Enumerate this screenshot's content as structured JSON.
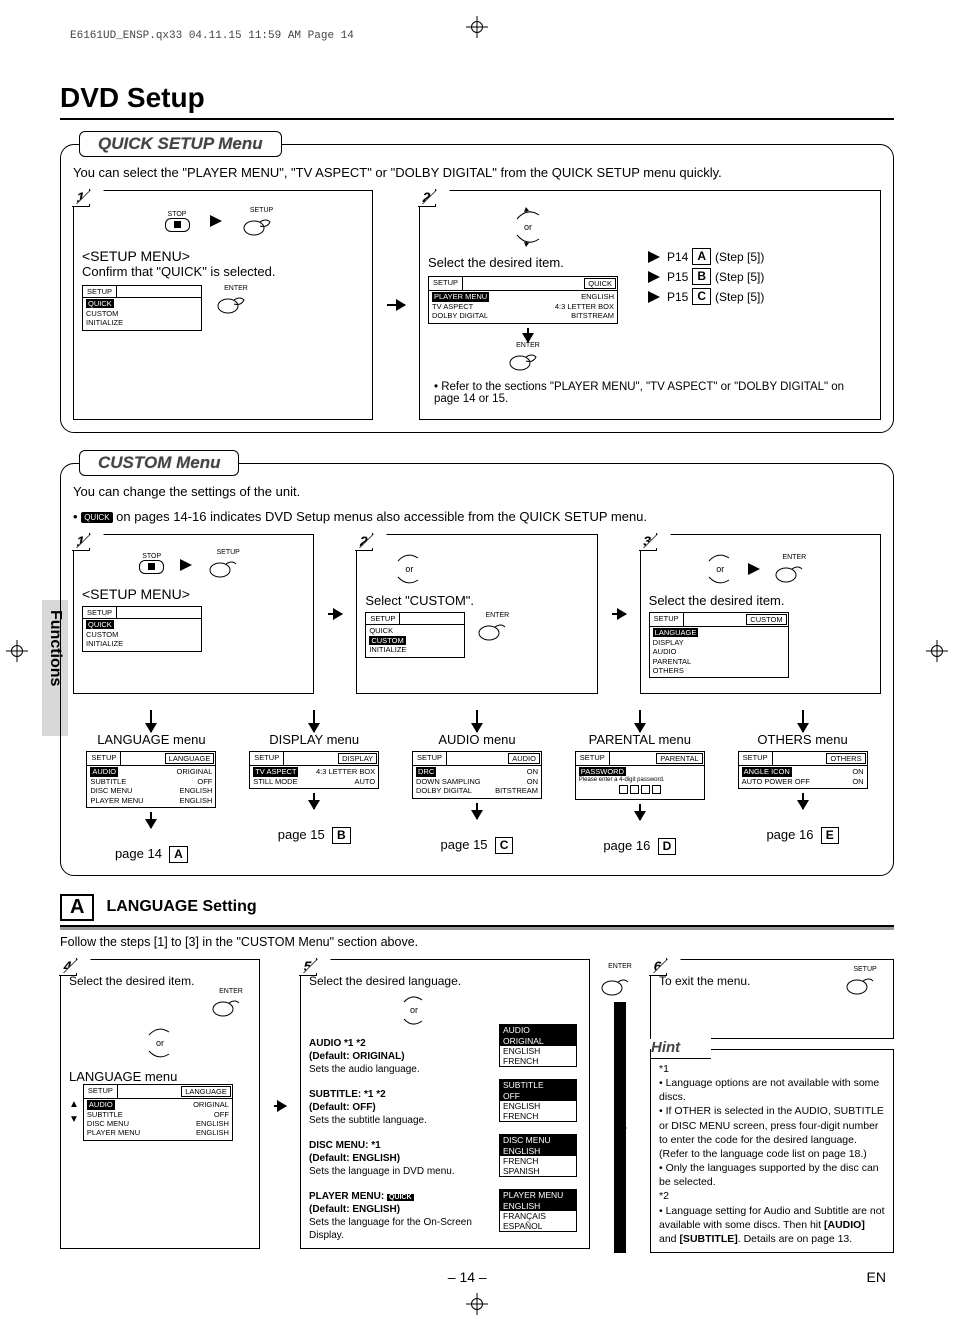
{
  "print_header": "E6161UD_ENSP.qx33  04.11.15 11:59 AM  Page 14",
  "title": "DVD Setup",
  "side_tab": "Functions",
  "quick": {
    "title": "QUICK SETUP Menu",
    "intro": "You can select the \"PLAYER MENU\", \"TV ASPECT\" or \"DOLBY DIGITAL\" from the QUICK SETUP menu quickly.",
    "step1": {
      "num": "1",
      "stop_label": "STOP",
      "setup_label": "SETUP",
      "heading": "<SETUP MENU>",
      "desc": "Confirm that \"QUICK\" is selected.",
      "menu_top": "SETUP",
      "menu_items": [
        "QUICK",
        "CUSTOM",
        "INITIALIZE"
      ],
      "enter_label": "ENTER"
    },
    "step2": {
      "num": "2",
      "or": "or",
      "desc": "Select the desired item.",
      "menu_top_l": "SETUP",
      "menu_top_r": "QUICK",
      "rows": [
        {
          "l": "PLAYER MENU",
          "r": "ENGLISH"
        },
        {
          "l": "TV ASPECT",
          "r": "4:3 LETTER BOX"
        },
        {
          "l": "DOLBY DIGITAL",
          "r": "BITSTREAM"
        }
      ],
      "enter_label": "ENTER",
      "ptrs": [
        {
          "p": "P14",
          "box": "A",
          "s": "(Step [5])"
        },
        {
          "p": "P15",
          "box": "B",
          "s": "(Step [5])"
        },
        {
          "p": "P15",
          "box": "C",
          "s": "(Step [5])"
        }
      ],
      "note": "• Refer to the sections \"PLAYER MENU\", \"TV ASPECT\" or \"DOLBY DIGITAL\" on page 14 or 15."
    }
  },
  "custom": {
    "title": "CUSTOM Menu",
    "intro1": "You can change the settings of the unit.",
    "intro2a": "•",
    "intro2_badge": "QUICK",
    "intro2b": " on pages 14-16 indicates DVD Setup menus also accessible from the QUICK SETUP menu.",
    "step1": {
      "num": "1",
      "stop_label": "STOP",
      "setup_label": "SETUP",
      "heading": "<SETUP MENU>",
      "menu_top": "SETUP",
      "menu_items": [
        "QUICK",
        "CUSTOM",
        "INITIALIZE"
      ]
    },
    "step2": {
      "num": "2",
      "or": "or",
      "desc": "Select \"CUSTOM\".",
      "menu_top": "SETUP",
      "menu_items": [
        "QUICK",
        "CUSTOM",
        "INITIALIZE"
      ],
      "enter_label": "ENTER"
    },
    "step3": {
      "num": "3",
      "or": "or",
      "enter_label": "ENTER",
      "desc": "Select the desired item.",
      "menu_top_l": "SETUP",
      "menu_top_r": "CUSTOM",
      "menu_items": [
        "LANGUAGE",
        "DISPLAY",
        "AUDIO",
        "PARENTAL",
        "OTHERS"
      ]
    },
    "menus": [
      {
        "title": "LANGUAGE menu",
        "top_l": "SETUP",
        "top_r": "LANGUAGE",
        "rows": [
          [
            "AUDIO",
            "ORIGINAL"
          ],
          [
            "SUBTITLE",
            "OFF"
          ],
          [
            "DISC MENU",
            "ENGLISH"
          ],
          [
            "PLAYER MENU",
            "ENGLISH"
          ]
        ],
        "page": "page 14",
        "box": "A"
      },
      {
        "title": "DISPLAY menu",
        "top_l": "SETUP",
        "top_r": "DISPLAY",
        "rows": [
          [
            "TV ASPECT",
            "4:3 LETTER BOX"
          ],
          [
            "STILL MODE",
            "AUTO"
          ]
        ],
        "page": "page 15",
        "box": "B"
      },
      {
        "title": "AUDIO menu",
        "top_l": "SETUP",
        "top_r": "AUDIO",
        "rows": [
          [
            "DRC",
            "ON"
          ],
          [
            "DOWN SAMPLING",
            "ON"
          ],
          [
            "DOLBY DIGITAL",
            "BITSTREAM"
          ]
        ],
        "page": "page 15",
        "box": "C"
      },
      {
        "title": "PARENTAL menu",
        "top_l": "SETUP",
        "top_r": "PARENTAL",
        "pw_label": "PASSWORD",
        "pw_msg": "Please enter a 4-digit password.",
        "page": "page 16",
        "box": "D"
      },
      {
        "title": "OTHERS menu",
        "top_l": "SETUP",
        "top_r": "OTHERS",
        "rows": [
          [
            "ANGLE ICON",
            "ON"
          ],
          [
            "AUTO POWER OFF",
            "ON"
          ]
        ],
        "page": "page 16",
        "box": "E"
      }
    ]
  },
  "lang_section": {
    "box": "A",
    "title": "LANGUAGE Setting",
    "follow": "Follow the steps [1] to [3] in the \"CUSTOM Menu\" section above.",
    "step4": {
      "num": "4",
      "desc": "Select the desired item.",
      "or": "or",
      "enter_label": "ENTER",
      "menu_title": "LANGUAGE menu",
      "top_l": "SETUP",
      "top_r": "LANGUAGE",
      "rows": [
        [
          "AUDIO",
          "ORIGINAL"
        ],
        [
          "SUBTITLE",
          "OFF"
        ],
        [
          "DISC MENU",
          "ENGLISH"
        ],
        [
          "PLAYER MENU",
          "ENGLISH"
        ]
      ]
    },
    "step5": {
      "num": "5",
      "desc": "Select the desired language.",
      "or": "or",
      "enter_label": "ENTER",
      "opts": [
        {
          "h": "AUDIO *1 *2",
          "d": "(Default: ORIGINAL)",
          "t": "Sets the audio language.",
          "list_top": "AUDIO",
          "list": [
            "ORIGINAL",
            "ENGLISH",
            "FRENCH"
          ]
        },
        {
          "h": "SUBTITLE: *1 *2",
          "d": "(Default: OFF)",
          "t": "Sets the subtitle language.",
          "list_top": "SUBTITLE",
          "list": [
            "OFF",
            "ENGLISH",
            "FRENCH"
          ]
        },
        {
          "h": "DISC MENU: *1",
          "d": "(Default: ENGLISH)",
          "t": "Sets the language in DVD menu.",
          "list_top": "DISC MENU",
          "list": [
            "ENGLISH",
            "FRENCH",
            "SPANISH"
          ]
        },
        {
          "h": "PLAYER MENU:",
          "badge": "QUICK",
          "d": "(Default: ENGLISH)",
          "t": "Sets the language for the On-Screen Display.",
          "list_top": "PLAYER MENU",
          "list": [
            "ENGLISH",
            "FRANÇAIS",
            "ESPAÑOL"
          ]
        }
      ]
    },
    "step6": {
      "num": "6",
      "desc": "To exit the menu.",
      "setup_label": "SETUP"
    },
    "hint": {
      "title": "Hint",
      "star1": "*1",
      "b1": "• Language options are not available with some discs.",
      "b2": "• If OTHER is selected in the AUDIO, SUBTITLE or DISC MENU screen, press four-digit number to enter the code for the desired language. (Refer to the language code list on page 18.)",
      "b3": "• Only the languages supported by the disc can be selected.",
      "star2": "*2",
      "b4a": "• Language setting for Audio and Subtitle are not available with some discs. Then hit ",
      "b4_audio": "[AUDIO]",
      "b4_and": " and ",
      "b4_sub": "[SUBTITLE]",
      "b4b": ". Details are on page 13."
    }
  },
  "footer": {
    "page": "– 14 –",
    "lang": "EN"
  }
}
